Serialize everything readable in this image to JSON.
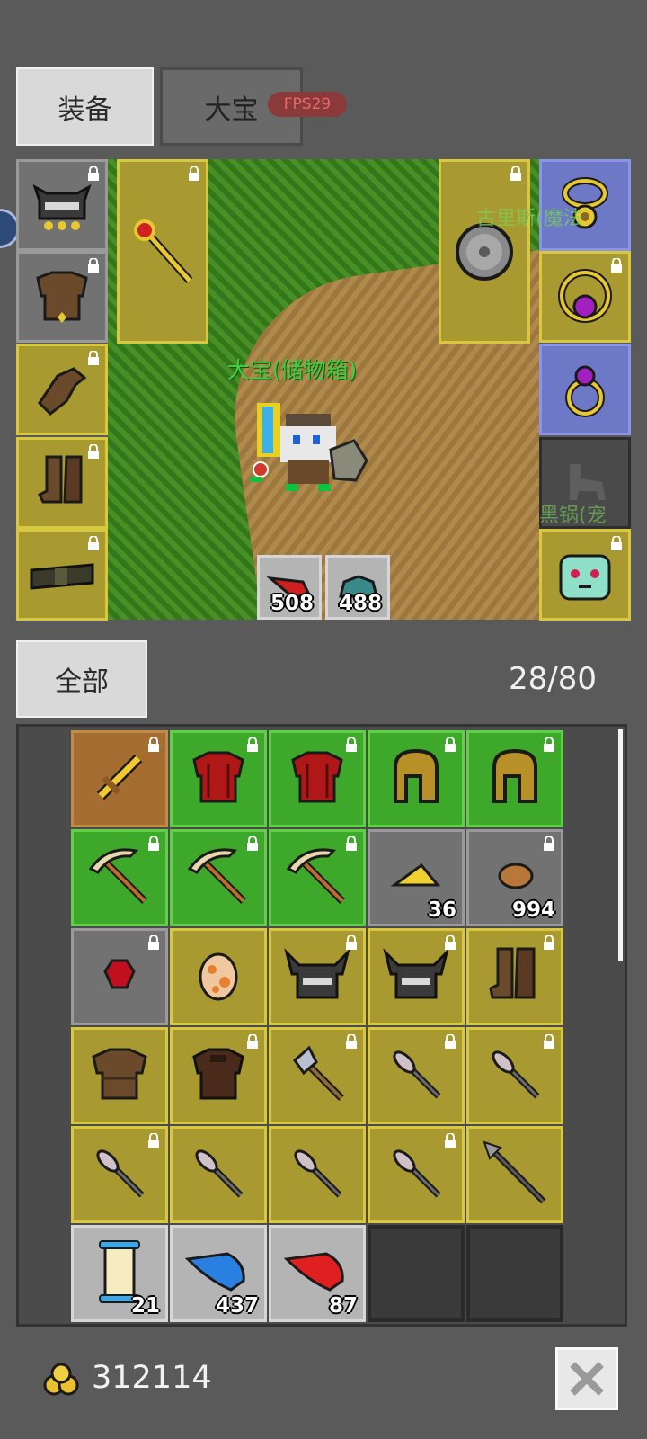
{
  "tabs": [
    {
      "label": "装备",
      "active": true
    },
    {
      "label": "大宝",
      "active": false
    }
  ],
  "fps_badge": "FPS29",
  "scene": {
    "character_name": "大宝(储物箱)",
    "npc_label": "古里斯(魔法",
    "npc_label_2": "黑锅(宠",
    "consumables": [
      {
        "icon": "red-feather-icon",
        "count": "508"
      },
      {
        "icon": "teal-helmet-icon",
        "count": "488"
      }
    ]
  },
  "equipment": {
    "left": [
      "helmet-icon",
      "chest-armor-icon",
      "gloves-icon",
      "boots-icon",
      "belt-icon"
    ],
    "weapon": "scepter-icon",
    "offhand": "round-shield-icon",
    "right": [
      "gold-necklace-icon",
      "purple-gem-necklace-icon",
      "purple-ring-icon",
      "pet-silhouette-icon",
      "pet-slime-icon"
    ]
  },
  "inventory": {
    "filter_label": "全部",
    "capacity": "28/80",
    "items": [
      {
        "icon": "golden-sword-icon",
        "rarity": "orange",
        "locked": true,
        "count": ""
      },
      {
        "icon": "red-armor-icon",
        "rarity": "green",
        "locked": true,
        "count": ""
      },
      {
        "icon": "red-armor-icon",
        "rarity": "green",
        "locked": true,
        "count": ""
      },
      {
        "icon": "gold-helmet-icon",
        "rarity": "green",
        "locked": true,
        "count": ""
      },
      {
        "icon": "gold-helmet-icon",
        "rarity": "green",
        "locked": true,
        "count": ""
      },
      {
        "icon": "pickaxe-icon",
        "rarity": "green",
        "locked": true,
        "count": ""
      },
      {
        "icon": "pickaxe-icon",
        "rarity": "green",
        "locked": true,
        "count": ""
      },
      {
        "icon": "pickaxe-icon",
        "rarity": "green",
        "locked": true,
        "count": ""
      },
      {
        "icon": "cheese-icon",
        "rarity": "gray",
        "locked": false,
        "count": "36"
      },
      {
        "icon": "meat-icon",
        "rarity": "gray",
        "locked": true,
        "count": "994"
      },
      {
        "icon": "ruby-icon",
        "rarity": "gray",
        "locked": true,
        "count": ""
      },
      {
        "icon": "egg-icon",
        "rarity": "yellow",
        "locked": false,
        "count": ""
      },
      {
        "icon": "horned-helmet-icon",
        "rarity": "yellow",
        "locked": true,
        "count": ""
      },
      {
        "icon": "horned-helmet-icon",
        "rarity": "yellow",
        "locked": true,
        "count": ""
      },
      {
        "icon": "leather-boots-icon",
        "rarity": "yellow",
        "locked": true,
        "count": ""
      },
      {
        "icon": "leather-armor-icon",
        "rarity": "yellow",
        "locked": false,
        "count": ""
      },
      {
        "icon": "dark-armor-icon",
        "rarity": "yellow",
        "locked": true,
        "count": ""
      },
      {
        "icon": "axe-icon",
        "rarity": "yellow",
        "locked": true,
        "count": ""
      },
      {
        "icon": "arrow-icon",
        "rarity": "yellow",
        "locked": true,
        "count": ""
      },
      {
        "icon": "arrow-icon",
        "rarity": "yellow",
        "locked": true,
        "count": ""
      },
      {
        "icon": "arrow-icon",
        "rarity": "yellow",
        "locked": true,
        "count": ""
      },
      {
        "icon": "arrow-icon",
        "rarity": "yellow",
        "locked": false,
        "count": ""
      },
      {
        "icon": "arrow-icon",
        "rarity": "yellow",
        "locked": false,
        "count": ""
      },
      {
        "icon": "arrow-icon",
        "rarity": "yellow",
        "locked": true,
        "count": ""
      },
      {
        "icon": "spear-icon",
        "rarity": "yellow",
        "locked": false,
        "count": ""
      },
      {
        "icon": "scroll-icon",
        "rarity": "lgray",
        "locked": false,
        "count": "21"
      },
      {
        "icon": "blue-feather-icon",
        "rarity": "lgray",
        "locked": false,
        "count": "437"
      },
      {
        "icon": "red-feather-icon",
        "rarity": "lgray",
        "locked": false,
        "count": "87"
      },
      {
        "icon": "",
        "rarity": "empty",
        "locked": false,
        "count": ""
      },
      {
        "icon": "",
        "rarity": "empty",
        "locked": false,
        "count": ""
      }
    ]
  },
  "footer": {
    "gold_icon": "gold-coins-icon",
    "gold_amount": "312114",
    "close_icon": "close-icon"
  },
  "colors": {
    "background": "#5a5a5a",
    "rarity_yellow": "#a89a30",
    "rarity_green": "#3da82a",
    "rarity_orange": "#a56d30",
    "slot_blue": "#6d78c6",
    "name_green": "#3fd03f"
  }
}
